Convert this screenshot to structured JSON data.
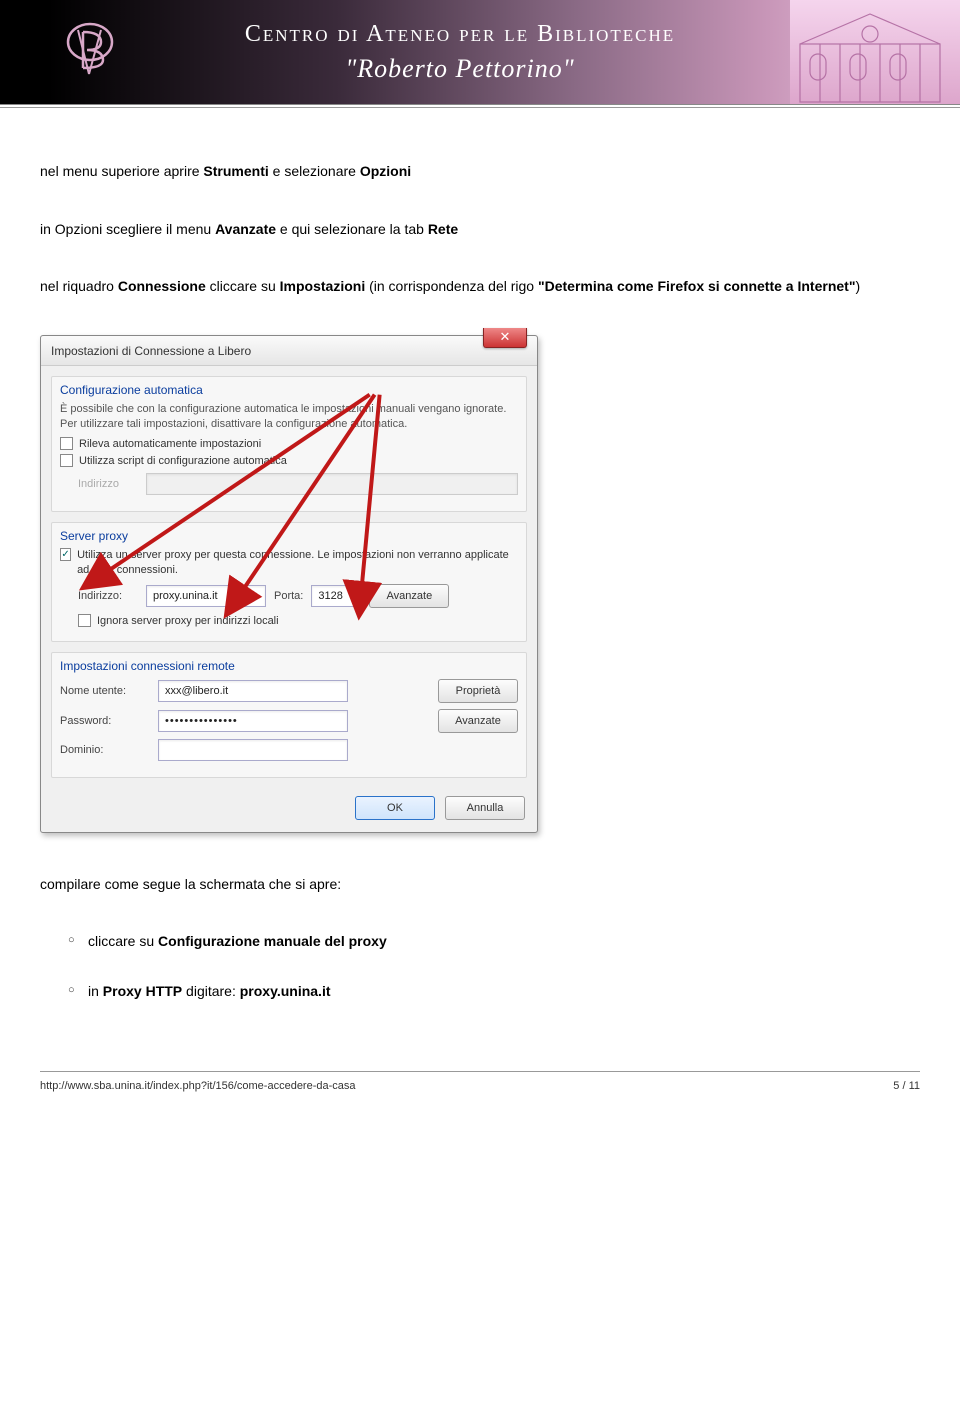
{
  "header": {
    "title_line1": "Centro di Ateneo per le Biblioteche",
    "title_line2": "\"Roberto Pettorino\"",
    "logo_sub": "CENTRO DI ATENEO PER LE BIBLIOTECHE"
  },
  "text": {
    "p1_a": "nel menu superiore aprire ",
    "p1_b": "Strumenti",
    "p1_c": " e selezionare ",
    "p1_d": "Opzioni",
    "p2_a": "in Opzioni scegliere il menu ",
    "p2_b": "Avanzate",
    "p2_c": " e qui selezionare la tab ",
    "p2_d": "Rete",
    "p3_a": "nel riquadro ",
    "p3_b": "Connessione",
    "p3_c": " cliccare su ",
    "p3_d": "Impostazioni",
    "p3_e": " (in corrispondenza del rigo ",
    "p3_f": "\"Determina come Firefox si connette a Internet\"",
    "p3_g": ")",
    "p4": "compilare come segue la schermata che si apre:",
    "b1_a": "cliccare su ",
    "b1_b": "Configurazione manuale del proxy",
    "b2_a": "in ",
    "b2_b": "Proxy HTTP",
    "b2_c": " digitare: ",
    "b2_d": "proxy.unina.it"
  },
  "dialog": {
    "title": "Impostazioni di Connessione a Libero",
    "close": "✕",
    "auto": {
      "heading": "Configurazione automatica",
      "desc": "È possibile che con la configurazione automatica le impostazioni manuali vengano ignorate. Per utilizzare tali impostazioni, disattivare la configurazione automatica.",
      "chk1": "Rileva automaticamente impostazioni",
      "chk2": "Utilizza script di configurazione automatica",
      "addr_label": "Indirizzo",
      "addr_value": ""
    },
    "proxy": {
      "heading": "Server proxy",
      "chk_label": "Utilizza un server proxy per questa connessione. Le impostazioni non verranno applicate ad altre connessioni.",
      "addr_label": "Indirizzo:",
      "addr_value": "proxy.unina.it",
      "port_label": "Porta:",
      "port_value": "3128",
      "adv_btn": "Avanzate",
      "bypass": "Ignora server proxy per indirizzi locali"
    },
    "remote": {
      "heading": "Impostazioni connessioni remote",
      "user_label": "Nome utente:",
      "user_value": "xxx@libero.it",
      "prop_btn": "Proprietà",
      "pass_label": "Password:",
      "pass_value": "•••••••••••••••",
      "adv_btn": "Avanzate",
      "domain_label": "Dominio:",
      "domain_value": ""
    },
    "ok": "OK",
    "cancel": "Annulla"
  },
  "footer": {
    "url": "http://www.sba.unina.it/index.php?it/156/come-accedere-da-casa",
    "page": "5 / 11"
  }
}
